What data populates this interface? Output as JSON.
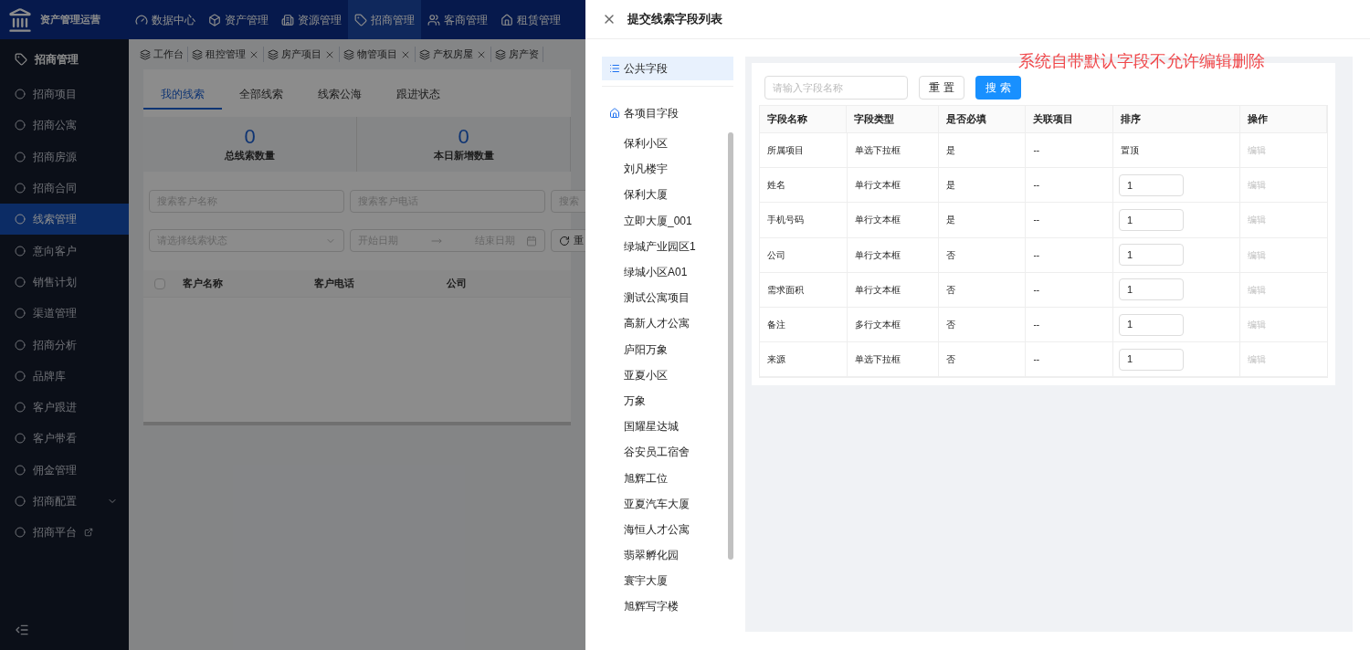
{
  "app": {
    "logo_text": "资产管理运营",
    "top_nav": [
      {
        "label": "数据中心",
        "selected": false
      },
      {
        "label": "资产管理",
        "selected": false
      },
      {
        "label": "资源管理",
        "selected": false
      },
      {
        "label": "招商管理",
        "selected": true
      },
      {
        "label": "客商管理",
        "selected": false
      },
      {
        "label": "租赁管理",
        "selected": false
      }
    ],
    "sidebar": {
      "title": "招商管理",
      "items": [
        {
          "label": "招商项目",
          "selected": false,
          "kind": "link"
        },
        {
          "label": "招商公寓",
          "selected": false,
          "kind": "link"
        },
        {
          "label": "招商房源",
          "selected": false,
          "kind": "link"
        },
        {
          "label": "招商合同",
          "selected": false,
          "kind": "link"
        },
        {
          "label": "线索管理",
          "selected": true,
          "kind": "link"
        },
        {
          "label": "意向客户",
          "selected": false,
          "kind": "link"
        },
        {
          "label": "销售计划",
          "selected": false,
          "kind": "link"
        },
        {
          "label": "渠道管理",
          "selected": false,
          "kind": "link"
        },
        {
          "label": "招商分析",
          "selected": false,
          "kind": "link"
        },
        {
          "label": "品牌库",
          "selected": false,
          "kind": "link"
        },
        {
          "label": "客户跟进",
          "selected": false,
          "kind": "link"
        },
        {
          "label": "客户带看",
          "selected": false,
          "kind": "link"
        },
        {
          "label": "佣金管理",
          "selected": false,
          "kind": "link"
        },
        {
          "label": "招商配置",
          "selected": false,
          "kind": "group"
        },
        {
          "label": "招商平台",
          "selected": false,
          "kind": "external"
        }
      ]
    },
    "page_tabs": [
      {
        "label": "工作台",
        "closable": false
      },
      {
        "label": "租控管理",
        "closable": true
      },
      {
        "label": "房产项目",
        "closable": true
      },
      {
        "label": "物管项目",
        "closable": true
      },
      {
        "label": "产权房屋",
        "closable": true
      },
      {
        "label": "房产资",
        "closable": false
      }
    ],
    "sub_tabs": [
      {
        "label": "我的线索",
        "selected": true
      },
      {
        "label": "全部线索",
        "selected": false
      },
      {
        "label": "线索公海",
        "selected": false
      },
      {
        "label": "跟进状态",
        "selected": false
      }
    ],
    "stats": [
      {
        "value": "0",
        "label": "总线索数量"
      },
      {
        "value": "0",
        "label": "本日新增数量"
      }
    ],
    "filters": {
      "name_placeholder": "搜索客户名称",
      "phone_placeholder": "搜索客户电话",
      "third_placeholder": "搜索",
      "status_placeholder": "请选择线索状态",
      "start_placeholder": "开始日期",
      "end_placeholder": "结束日期",
      "reset_button": "重"
    },
    "table": {
      "select_all": {
        "checked": false
      },
      "columns": [
        "客户名称",
        "客户电话",
        "公司"
      ]
    }
  },
  "drawer": {
    "title": "提交线索字段列表",
    "groups": [
      {
        "label": "公共字段",
        "selected": true
      },
      {
        "label": "各项目字段",
        "selected": false
      }
    ],
    "projects": [
      {
        "label": "保利小区",
        "selected": false
      },
      {
        "label": "刘凡楼宇",
        "selected": false
      },
      {
        "label": "保利大厦",
        "selected": false
      },
      {
        "label": "立即大厦_001",
        "selected": false
      },
      {
        "label": "绿城产业园区1",
        "selected": false
      },
      {
        "label": "绿城小区A01",
        "selected": false
      },
      {
        "label": "测试公寓项目",
        "selected": false
      },
      {
        "label": "高新人才公寓",
        "selected": false
      },
      {
        "label": "庐阳万象",
        "selected": false
      },
      {
        "label": "亚夏小区",
        "selected": false
      },
      {
        "label": "万象",
        "selected": false
      },
      {
        "label": "国耀星达城",
        "selected": false
      },
      {
        "label": "谷安员工宿舍",
        "selected": false
      },
      {
        "label": "旭辉工位",
        "selected": false
      },
      {
        "label": "亚夏汽车大厦",
        "selected": false
      },
      {
        "label": "海恒人才公寓",
        "selected": false
      },
      {
        "label": "翡翠孵化园",
        "selected": false
      },
      {
        "label": "寰宇大厦",
        "selected": false
      },
      {
        "label": "旭辉写字楼",
        "selected": false
      }
    ],
    "notice": "系统自带默认字段不允许编辑删除",
    "search_placeholder": "请输入字段名称",
    "reset_button": "重 置",
    "search_button": "搜 索",
    "columns": [
      "字段名称",
      "字段类型",
      "是否必填",
      "关联项目",
      "排序",
      "操作"
    ],
    "rows": [
      {
        "name": "所属项目",
        "type": "单选下拉框",
        "required": "是",
        "project": "--",
        "kind": "text",
        "sort": "置顶",
        "action": "编辑",
        "disabled": true
      },
      {
        "name": "姓名",
        "type": "单行文本框",
        "required": "是",
        "project": "--",
        "kind": "input",
        "sort": "1",
        "action": "编辑",
        "disabled": true
      },
      {
        "name": "手机号码",
        "type": "单行文本框",
        "required": "是",
        "project": "--",
        "kind": "input",
        "sort": "1",
        "action": "编辑",
        "disabled": true
      },
      {
        "name": "公司",
        "type": "单行文本框",
        "required": "否",
        "project": "--",
        "kind": "input",
        "sort": "1",
        "action": "编辑",
        "disabled": true
      },
      {
        "name": "需求面积",
        "type": "单行文本框",
        "required": "否",
        "project": "--",
        "kind": "input",
        "sort": "1",
        "action": "编辑",
        "disabled": true
      },
      {
        "name": "备注",
        "type": "多行文本框",
        "required": "否",
        "project": "--",
        "kind": "input",
        "sort": "1",
        "action": "编辑",
        "disabled": true
      },
      {
        "name": "来源",
        "type": "单选下拉框",
        "required": "否",
        "project": "--",
        "kind": "input",
        "sort": "1",
        "action": "编辑",
        "disabled": true
      }
    ]
  }
}
